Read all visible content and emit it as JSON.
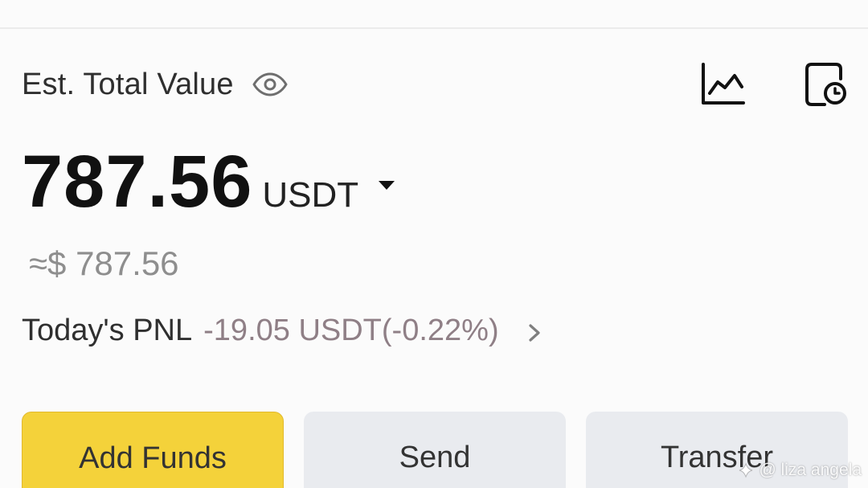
{
  "header": {
    "label": "Est. Total Value",
    "visibility_icon": "eye-icon",
    "right_icons": [
      "chart-icon",
      "history-icon"
    ]
  },
  "balance": {
    "value": "787.56",
    "unit": "USDT",
    "approx": "≈$ 787.56"
  },
  "pnl": {
    "label": "Today's PNL",
    "value": "-19.05 USDT(-0.22%)"
  },
  "buttons": {
    "add_funds": "Add Funds",
    "send": "Send",
    "transfer": "Transfer"
  },
  "watermark": {
    "text": "@ liza angela"
  },
  "colors": {
    "background": "#fbfbfb",
    "primary_button": "#f4d23a",
    "secondary_button": "#e9ebef",
    "pnl_negative": "#8f7f86"
  }
}
